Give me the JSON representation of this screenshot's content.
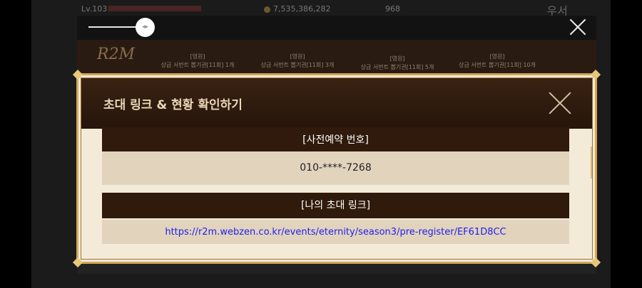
{
  "hud": {
    "level": "Lv.103",
    "coins": "7,535,386,282",
    "gems": "968",
    "title": "우서"
  },
  "banner": {
    "logo": "R2M",
    "rewards": [
      {
        "line1": "[영원]",
        "line2": "상급 서번트 뽑기권[11회] 1개"
      },
      {
        "line1": "[영원]",
        "line2": "상급 서번트 뽑기권[11회] 3개"
      },
      {
        "line1": "[영원]",
        "line2": "상급 서번트 뽑기권[11회] 5개"
      },
      {
        "line1": "[영원]",
        "line2": "상급 서번트 뽑기권[11회] 10개"
      }
    ]
  },
  "modal": {
    "title": "초대 링크 & 현황 확인하기",
    "reg_label": "[사전예약 번호]",
    "reg_value": "010-****-7268",
    "link_label": "[나의 초대 링크]",
    "link_url": "https://r2m.webzen.co.kr/events/eternity/season3/pre-register/EF61D8CC"
  },
  "slider": {
    "thumb_glyph": "◂▸"
  },
  "colors": {
    "modal_bg": "#f4ead8",
    "modal_border": "#d3a657",
    "header_bg": "#3a2212",
    "section_head": "#2f1a0c",
    "section_body": "#e2d3bd",
    "link": "#2020ee"
  }
}
